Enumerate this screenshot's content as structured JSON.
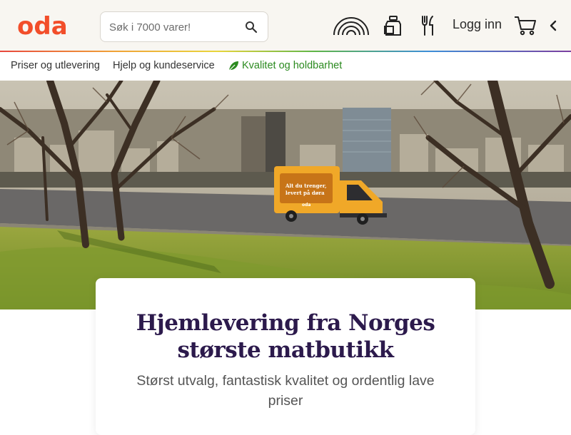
{
  "header": {
    "logo_text": "oda",
    "search": {
      "placeholder": "Søk i 7000 varer!"
    },
    "login_label": "Logg inn",
    "icons": [
      "rainbow-icon",
      "jar-icon",
      "cutlery-icon",
      "cart-icon",
      "chevron-left-icon"
    ]
  },
  "subnav": {
    "items": [
      {
        "label": "Priser og utlevering"
      },
      {
        "label": "Hjelp og kundeservice"
      },
      {
        "label": "Kvalitet og holdbarhet",
        "icon": "leaf-icon"
      }
    ]
  },
  "hero": {
    "van_text": "Alt du trenger, levert på døra",
    "van_logo": "oda"
  },
  "card": {
    "title": "Hjemlevering fra Norges største matbutikk",
    "subtitle": "Størst utvalg, fantastisk kvalitet og ordentlig lave priser"
  },
  "colors": {
    "brand": "#f24e2a",
    "accent_green": "#2b8a1f",
    "title_purple": "#2c1a4c",
    "header_bg": "#f8f6f1"
  }
}
